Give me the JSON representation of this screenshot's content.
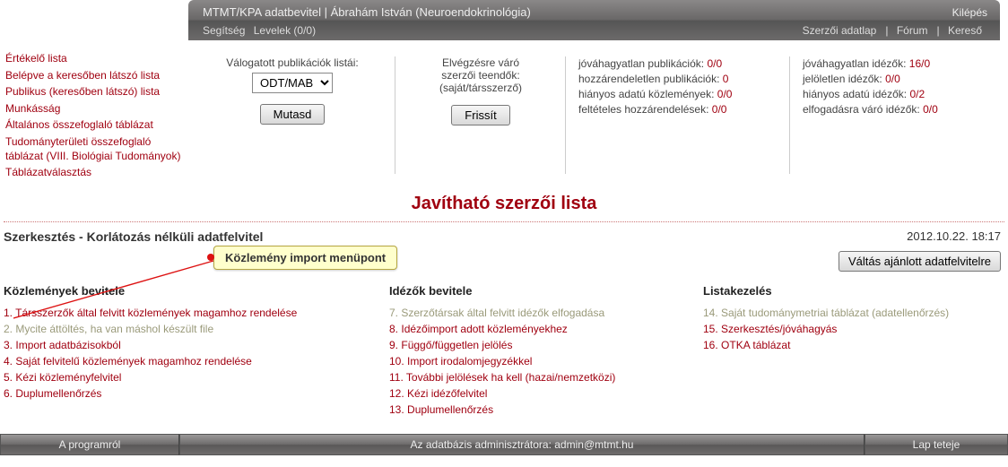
{
  "header": {
    "title": "MTMT/KPA adatbevitel | Ábrahám István (Neuroendokrinológia)",
    "logout": "Kilépés",
    "left_links": [
      "Segítség",
      "Levelek (0/0)"
    ],
    "right_links": [
      "Szerzői adatlap",
      "Fórum",
      "Kereső"
    ]
  },
  "sidebar": [
    "Értékelő lista",
    "Belépve a keresőben látszó lista",
    "Publikus (keresőben látszó) lista",
    "Munkásság",
    "Általános összefoglaló táblázat",
    "Tudományterületi összefoglaló táblázat (VIII. Biológiai Tudományok)",
    "Táblázatválasztás"
  ],
  "panel1": {
    "heading": "Válogatott publikációk listái:",
    "select_value": "ODT/MAB",
    "button": "Mutasd"
  },
  "panel2": {
    "line1": "Elvégzésre váró",
    "line2": "szerzői teendők:",
    "line3": "(saját/társszerző)",
    "button": "Frissít"
  },
  "stats1": [
    {
      "label": "jóváhagyatlan publikációk:",
      "val": "0/0"
    },
    {
      "label": "hozzárendeletlen publikációk:",
      "val": "0"
    },
    {
      "label": "hiányos adatú közlemények:",
      "val": "0/0"
    },
    {
      "label": "feltételes hozzárendelések:",
      "val": "0/0"
    }
  ],
  "stats2": [
    {
      "label": "jóváhagyatlan idézők:",
      "val": "16/0"
    },
    {
      "label": "jelöletlen idézők:",
      "val": "0/0"
    },
    {
      "label": "hiányos adatú idézők:",
      "val": "0/2"
    },
    {
      "label": "elfogadásra váró idézők:",
      "val": "0/0"
    }
  ],
  "bigtitle": "Javítható szerzői lista",
  "subhead": {
    "left": "Szerkesztés - Korlátozás nélküli adatfelvitel",
    "right": "2012.10.22. 18:17"
  },
  "switch_button": "Váltás ajánlott adatfelvitelre",
  "callout": "Közlemény import menüpont",
  "col1": {
    "title": "Közlemények bevitele",
    "items": [
      {
        "n": "1.",
        "t": "Társszerzők által felvitt közlemények magamhoz rendelése",
        "disabled": false
      },
      {
        "n": "2.",
        "t": "Mycite áttöltés, ha van máshol készült file",
        "disabled": true
      },
      {
        "n": "3.",
        "t": "Import adatbázisokból",
        "disabled": false
      },
      {
        "n": "4.",
        "t": "Saját felvitelű közlemények magamhoz rendelése",
        "disabled": false
      },
      {
        "n": "5.",
        "t": "Kézi közleményfelvitel",
        "disabled": false
      },
      {
        "n": "6.",
        "t": "Duplumellenőrzés",
        "disabled": false
      }
    ]
  },
  "col2": {
    "title": "Idézők bevitele",
    "items": [
      {
        "n": "7.",
        "t": "Szerzőtársak által felvitt idézők elfogadása",
        "disabled": true
      },
      {
        "n": "8.",
        "t": "Idézőimport adott közleményekhez",
        "disabled": false
      },
      {
        "n": "9.",
        "t": "Függő/független jelölés",
        "disabled": false
      },
      {
        "n": "10.",
        "t": "Import irodalomjegyzékkel",
        "disabled": false
      },
      {
        "n": "11.",
        "t": "További jelölések ha kell (hazai/nemzetközi)",
        "disabled": false
      },
      {
        "n": "12.",
        "t": "Kézi idézőfelvitel",
        "disabled": false
      },
      {
        "n": "13.",
        "t": "Duplumellenőrzés",
        "disabled": false
      }
    ]
  },
  "col3": {
    "title": "Listakezelés",
    "items": [
      {
        "n": "14.",
        "t": "Saját tudománymetriai táblázat (adatellenőrzés)",
        "disabled": true
      },
      {
        "n": "15.",
        "t": "Szerkesztés/jóváhagyás",
        "disabled": false
      },
      {
        "n": "16.",
        "t": "OTKA táblázat",
        "disabled": false
      }
    ]
  },
  "footer": {
    "left": "A programról",
    "mid": "Az adatbázis adminisztrátora: admin@mtmt.hu",
    "right": "Lap teteje"
  }
}
